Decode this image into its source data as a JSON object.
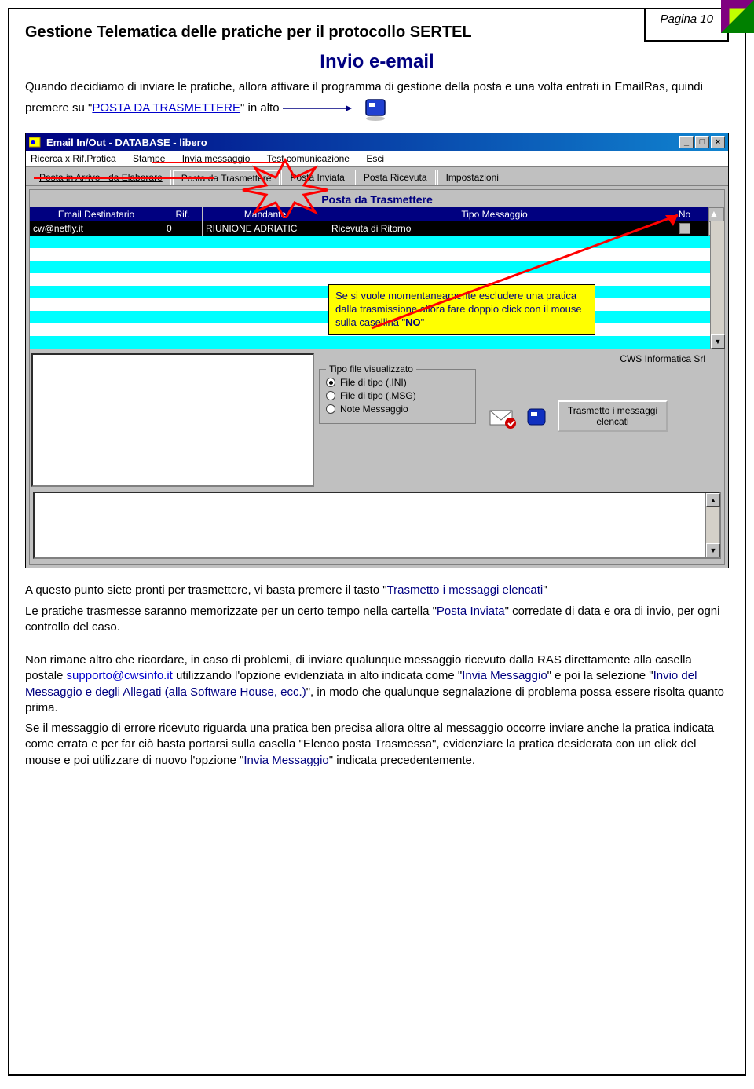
{
  "header": {
    "title": "Gestione Telematica delle pratiche per il protocollo SERTEL",
    "page_label": "Pagina 10"
  },
  "section_title": "Invio e-email",
  "intro": {
    "part1": "Quando decidiamo di inviare le pratiche, allora attivare il programma di gestione della posta e una volta entrati in EmailRas, quindi premere su \"",
    "link": "POSTA DA TRASMETTERE",
    "part2": "\" in alto"
  },
  "app": {
    "titlebar": "Email In/Out - DATABASE  - libero",
    "menu": [
      "Ricerca x Rif.Pratica",
      "Stampe",
      "Invia messaggio",
      "Test comunicazione",
      "Esci"
    ],
    "tabs": [
      "Posta in Arrivo - da Elaborare",
      "Posta da Trasmettere",
      "Posta Inviata",
      "Posta Ricevuta",
      "Impostazioni"
    ],
    "section_label": "Posta da Trasmettere",
    "grid_headers": {
      "email": "Email Destinatario",
      "rif": "Rif.",
      "mand": "Mandante",
      "tipo": "Tipo Messaggio",
      "no": "No"
    },
    "grid_row": {
      "email": "cw@netfly.it",
      "rif": "0",
      "mand": "RIUNIONE ADRIATIC",
      "tipo": "Ricevuta di Ritorno"
    },
    "company": "CWS Informatica Srl",
    "fieldset_legend": "Tipo file visualizzato",
    "radios": [
      "File di tipo (.INI)",
      "File di tipo (.MSG)",
      "Note Messaggio"
    ],
    "transmit_btn": "Trasmetto i messaggi elencati"
  },
  "callout": {
    "part1": "Se si vuole momentaneamente escludere una pratica dalla trasmissione allora fare doppio click con il mouse sulla casellina \"",
    "bold": "NO",
    "part2": "\""
  },
  "para2": {
    "a": "A questo punto siete pronti per trasmettere, vi basta premere il tasto \"",
    "b": "Trasmetto i messaggi elencati",
    "c": "\""
  },
  "para3": {
    "a": "Le pratiche trasmesse saranno memorizzate per un certo tempo nella cartella \"",
    "b": "Posta Inviata",
    "c": "\" corredate di data e ora di invio, per ogni controllo del caso."
  },
  "para4": {
    "a": "Non rimane altro che ricordare, in caso di problemi, di inviare qualunque messaggio ricevuto dalla  RAS direttamente alla casella postale ",
    "email": "supporto@cwsinfo.it",
    "b": " utilizzando l'opzione evidenziata in alto indicata come \"",
    "c": "Invia Messaggio",
    "d": "\" e poi la selezione \"",
    "e": "Invio del Messaggio e degli Allegati (alla Software House, ecc.)",
    "f": "\", in modo che qualunque segnalazione di problema possa essere risolta quanto prima."
  },
  "para5": {
    "a": "Se il messaggio di errore ricevuto riguarda una pratica ben precisa allora oltre al messaggio occorre inviare anche la pratica indicata come errata e per far ciò basta portarsi sulla casella \"Elenco posta Trasmessa\", evidenziare la pratica desiderata con un click del mouse e poi utilizzare di nuovo l'opzione \"",
    "b": "Invia Messaggio",
    "c": "\" indicata precedentemente."
  }
}
